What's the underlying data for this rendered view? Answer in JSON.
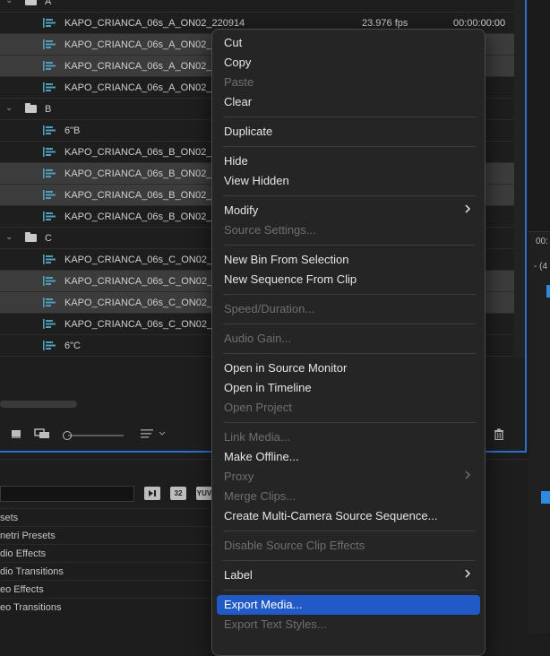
{
  "project": {
    "bins": [
      {
        "name": "A",
        "clips": [
          {
            "name": "KAPO_CRIANCA_06s_A_ON02_220914",
            "fps": "23.976 fps",
            "tc": "00:00:00:00",
            "selected": false
          },
          {
            "name": "KAPO_CRIANCA_06s_A_ON02_",
            "tc": ":00",
            "selected": true
          },
          {
            "name": "KAPO_CRIANCA_06s_A_ON02_",
            "tc": ":00",
            "selected": true
          },
          {
            "name": "KAPO_CRIANCA_06s_A_ON02_",
            "tc": ":00",
            "selected": false
          }
        ]
      },
      {
        "name": "B",
        "clips": [
          {
            "name": "6\"B",
            "tc": ":00",
            "selected": false
          },
          {
            "name": "KAPO_CRIANCA_06s_B_ON02_",
            "tc": ":00",
            "selected": false
          },
          {
            "name": "KAPO_CRIANCA_06s_B_ON02_",
            "tc": ":00",
            "selected": true
          },
          {
            "name": "KAPO_CRIANCA_06s_B_ON02_",
            "tc": ":00",
            "selected": true
          },
          {
            "name": "KAPO_CRIANCA_06s_B_ON02_",
            "tc": ":00",
            "selected": false
          }
        ]
      },
      {
        "name": "C",
        "clips": [
          {
            "name": "KAPO_CRIANCA_06s_C_ON02_",
            "tc": ":00",
            "selected": false
          },
          {
            "name": "KAPO_CRIANCA_06s_C_ON02_",
            "tc": ":00",
            "selected": true
          },
          {
            "name": "KAPO_CRIANCA_06s_C_ON02_",
            "tc": ":00",
            "selected": true
          },
          {
            "name": "KAPO_CRIANCA_06s_C_ON02_",
            "tc": ":00",
            "selected": false
          },
          {
            "name": "6\"C",
            "tc": ":00",
            "selected": false
          }
        ]
      }
    ]
  },
  "toolbar": {
    "icons": [
      "freeform-view-icon",
      "stack-icon",
      "zoom-slider",
      "sort-icon",
      "trash-icon"
    ]
  },
  "effects": {
    "buttons": [
      "32",
      "YUV"
    ],
    "items": [
      "sets",
      "netri Presets",
      "dio Effects",
      "dio Transitions",
      "eo Effects",
      "eo Transitions"
    ]
  },
  "right_panel": {
    "tc_fragment": "00:",
    "minus": "- (4"
  },
  "menu": {
    "items": [
      {
        "label": "Cut",
        "disabled": false
      },
      {
        "label": "Copy",
        "disabled": false
      },
      {
        "label": "Paste",
        "disabled": true
      },
      {
        "label": "Clear",
        "disabled": false
      },
      {
        "sep": true
      },
      {
        "label": "Duplicate",
        "disabled": false
      },
      {
        "sep": true
      },
      {
        "label": "Hide",
        "disabled": false
      },
      {
        "label": "View Hidden",
        "disabled": false
      },
      {
        "sep": true
      },
      {
        "label": "Modify",
        "disabled": false,
        "submenu": true
      },
      {
        "label": "Source Settings...",
        "disabled": true
      },
      {
        "sep": true
      },
      {
        "label": "New Bin From Selection",
        "disabled": false
      },
      {
        "label": "New Sequence From Clip",
        "disabled": false
      },
      {
        "sep": true
      },
      {
        "label": "Speed/Duration...",
        "disabled": true
      },
      {
        "sep": true
      },
      {
        "label": "Audio Gain...",
        "disabled": true
      },
      {
        "sep": true
      },
      {
        "label": "Open in Source Monitor",
        "disabled": false
      },
      {
        "label": "Open in Timeline",
        "disabled": false
      },
      {
        "label": "Open Project",
        "disabled": true
      },
      {
        "sep": true
      },
      {
        "label": "Link Media...",
        "disabled": true
      },
      {
        "label": "Make Offline...",
        "disabled": false
      },
      {
        "label": "Proxy",
        "disabled": true,
        "submenu": true
      },
      {
        "label": "Merge Clips...",
        "disabled": true
      },
      {
        "label": "Create Multi-Camera Source Sequence...",
        "disabled": false
      },
      {
        "sep": true
      },
      {
        "label": "Disable Source Clip Effects",
        "disabled": true
      },
      {
        "sep": true
      },
      {
        "label": "Label",
        "disabled": false,
        "submenu": true
      },
      {
        "sep": true
      },
      {
        "label": "Export Media...",
        "disabled": false,
        "highlighted": true
      },
      {
        "label": "Export Text Styles...",
        "disabled": true
      }
    ]
  }
}
